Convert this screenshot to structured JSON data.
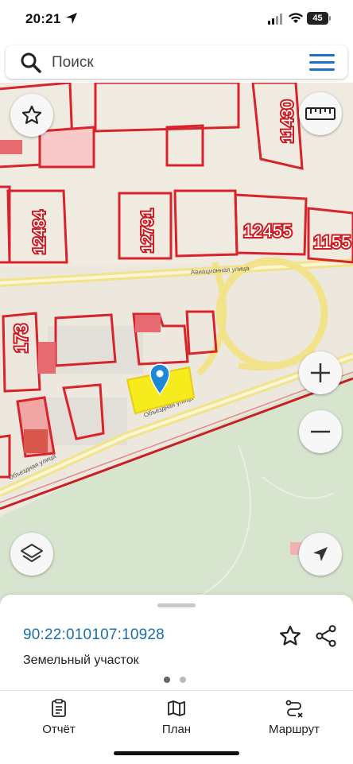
{
  "status_bar": {
    "time": "20:21",
    "battery": "45"
  },
  "search": {
    "placeholder": "Поиск"
  },
  "map": {
    "street_labels": [
      "Авиационная улица",
      "Объездная улица",
      "Объездная улица"
    ],
    "parcel_numbers": [
      "11430",
      "12484",
      "12791",
      "12455",
      "1155",
      "173"
    ],
    "colors": {
      "parcel_border": "#d8232a",
      "selected_parcel": "#f6ec1d",
      "pin": "#1e88d8",
      "park": "#d6e4cf",
      "road": "#f3e27a"
    },
    "icons": [
      "star-icon",
      "ruler-icon",
      "plus-icon",
      "minus-icon",
      "layers-icon",
      "navigation-arrow-icon",
      "location-pin-icon"
    ]
  },
  "sheet": {
    "cadastral_number": "90:22:010107:10928",
    "object_type": "Земельный участок",
    "page_dots": {
      "count": 2,
      "active": 1
    }
  },
  "tabs": [
    {
      "label": "Отчёт",
      "icon": "report-icon"
    },
    {
      "label": "План",
      "icon": "map-icon"
    },
    {
      "label": "Маршрут",
      "icon": "route-icon"
    }
  ]
}
